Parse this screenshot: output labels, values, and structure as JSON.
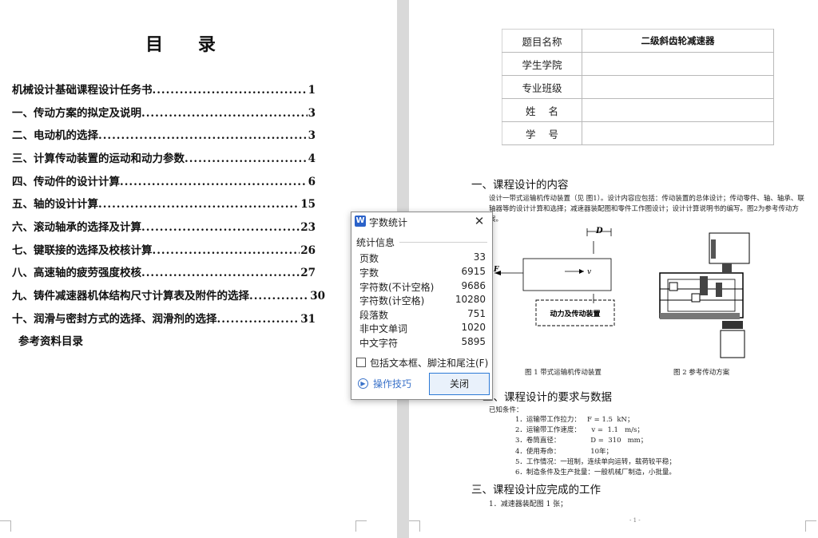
{
  "toc": {
    "title": "目 录",
    "entries": [
      {
        "text": "机械设计基础课程设计任务书",
        "page": "1"
      },
      {
        "text": "一、传动方案的拟定及说明",
        "page": "3"
      },
      {
        "text": "二、电动机的选择",
        "page": "3"
      },
      {
        "text": "三、计算传动装置的运动和动力参数",
        "page": "4"
      },
      {
        "text": "四、传动件的设计计算",
        "page": "6"
      },
      {
        "text": "五、轴的设计计算",
        "page": "15"
      },
      {
        "text": "六、滚动轴承的选择及计算",
        "page": "23"
      },
      {
        "text": "七、键联接的选择及校核计算",
        "page": "26"
      },
      {
        "text": "八、高速轴的疲劳强度校核",
        "page": "27"
      },
      {
        "text": "九、铸件减速器机体结构尺寸计算表及附件的选择",
        "page": "30"
      },
      {
        "text": "十、润滑与密封方式的选择、润滑剂的选择",
        "page": "31"
      }
    ],
    "references": "参考资料目录"
  },
  "info_table": {
    "rows": [
      {
        "label": "题目名称",
        "value": "二级斜齿轮减速器"
      },
      {
        "label": "学生学院",
        "value": ""
      },
      {
        "label": "专业班级",
        "value": ""
      },
      {
        "label": "姓    名",
        "value": ""
      },
      {
        "label": "学    号",
        "value": ""
      }
    ]
  },
  "content": {
    "section1_title": "一、课程设计的内容",
    "section1_para": "设计一带式运输机传动装置（见 图1）。设计内容应包括：传动装置的总体设计；传动零件、轴、轴承、联轴器等的设计计算和选择；减速器装配图和零件工作图设计；设计计算说明书的编写。图2为参考传动方案。",
    "fig1_labels": {
      "D": "D",
      "F": "F",
      "v": "v",
      "box": "动力及传动装置"
    },
    "fig1_caption": "图 1  带式运输机传动装置",
    "fig2_caption": "图 2  参考传动方案",
    "section2_title": "二、课程设计的要求与数据",
    "known": "已知条件：",
    "conditions": [
      "1．运输带工作拉力：   F = 1.5  kN；",
      "2．运输带工作速度：     v =  1.1   m/s；",
      "3．卷筒直径：              D =  310   mm；",
      "4．使用寿命：              10年；",
      "5．工作情况：一班制，连续单向运转，载荷较平稳；",
      "6．制造条件及生产批量：一般机械厂制造，小批量。"
    ],
    "section3_title": "三、课程设计应完成的工作",
    "work_item1": "1．减速器装配图 1 张；",
    "page_footer": "- 1 -"
  },
  "dialog": {
    "app_icon": "W",
    "title": "字数统计",
    "section": "统计信息",
    "stats": [
      {
        "label": "页数",
        "value": "33"
      },
      {
        "label": "字数",
        "value": "6915"
      },
      {
        "label": "字符数(不计空格)",
        "value": "9686"
      },
      {
        "label": "字符数(计空格)",
        "value": "10280"
      },
      {
        "label": "段落数",
        "value": "751"
      },
      {
        "label": "非中文单词",
        "value": "1020"
      },
      {
        "label": "中文字符",
        "value": "5895"
      }
    ],
    "checkbox_label": "包括文本框、脚注和尾注(F)",
    "tips_label": "操作技巧",
    "close_label": "关闭"
  }
}
